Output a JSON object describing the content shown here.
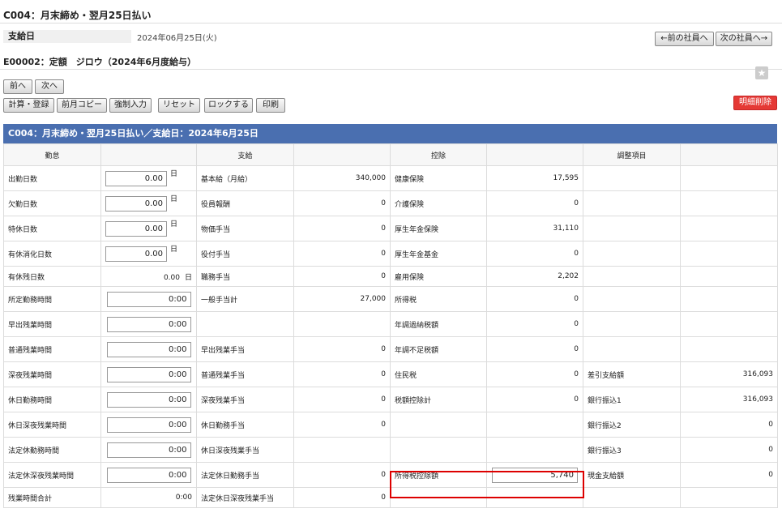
{
  "header": {
    "title": "C004：月末締め・翌月25日払い",
    "pay_label": "支給日",
    "pay_date": "2024年06月25日(火)",
    "prev_employee": "←前の社員へ",
    "next_employee": "次の社員へ→",
    "employee": "E00002：定額　ジロウ（2024年6月度給与）"
  },
  "toolbar": {
    "prev": "前へ",
    "next": "次へ",
    "calc": "計算・登録",
    "copy": "前月コピー",
    "force": "強制入力",
    "reset": "リセット",
    "lock": "ロックする",
    "print": "印刷",
    "delete": "明細削除"
  },
  "banner": "C004：月末締め・翌月25日払い／支給日：2024年6月25日",
  "columns": {
    "attendance": "勤怠",
    "payment": "支給",
    "deduction": "控除",
    "adjust": "調整項目"
  },
  "rows": [
    {
      "a": "出勤日数",
      "av": "0.00",
      "au": "日",
      "p": "基本給（月給）",
      "pv": "340,000",
      "d": "健康保険",
      "dv": "17,595",
      "j": "",
      "jv": ""
    },
    {
      "a": "欠勤日数",
      "av": "0.00",
      "au": "日",
      "p": "役員報酬",
      "pv": "0",
      "d": "介護保険",
      "dv": "0",
      "j": "",
      "jv": ""
    },
    {
      "a": "特休日数",
      "av": "0.00",
      "au": "日",
      "p": "物価手当",
      "pv": "0",
      "d": "厚生年金保険",
      "dv": "31,110",
      "j": "",
      "jv": ""
    },
    {
      "a": "有休消化日数",
      "av": "0.00",
      "au": "日",
      "p": "役付手当",
      "pv": "0",
      "d": "厚生年金基金",
      "dv": "0",
      "j": "",
      "jv": ""
    },
    {
      "a": "有休残日数",
      "av": "0.00",
      "au": "日",
      "p": "職務手当",
      "pv": "0",
      "d": "雇用保険",
      "dv": "2,202",
      "j": "",
      "jv": ""
    },
    {
      "a": "所定勤務時間",
      "av": "0:00",
      "au": "",
      "p": "一般手当計",
      "pv": "27,000",
      "d": "所得税",
      "dv": "0",
      "j": "",
      "jv": ""
    },
    {
      "a": "早出残業時間",
      "av": "0:00",
      "au": "",
      "p": "",
      "pv": "",
      "d": "年調過納税額",
      "dv": "0",
      "j": "",
      "jv": ""
    },
    {
      "a": "普通残業時間",
      "av": "0:00",
      "au": "",
      "p": "早出残業手当",
      "pv": "0",
      "d": "年調不足税額",
      "dv": "0",
      "j": "",
      "jv": ""
    },
    {
      "a": "深夜残業時間",
      "av": "0:00",
      "au": "",
      "p": "普通残業手当",
      "pv": "0",
      "d": "住民税",
      "dv": "0",
      "j": "差引支給額",
      "jv": "316,093"
    },
    {
      "a": "休日勤務時間",
      "av": "0:00",
      "au": "",
      "p": "深夜残業手当",
      "pv": "0",
      "d": "税額控除計",
      "dv": "0",
      "j": "銀行振込1",
      "jv": "316,093"
    },
    {
      "a": "休日深夜残業時間",
      "av": "0:00",
      "au": "",
      "p": "休日勤務手当",
      "pv": "0",
      "d": "",
      "dv": "",
      "j": "銀行振込2",
      "jv": "0"
    },
    {
      "a": "法定休勤務時間",
      "av": "0:00",
      "au": "",
      "p": "休日深夜残業手当",
      "pv": "",
      "d": "",
      "dv": "",
      "j": "銀行振込3",
      "jv": "0"
    },
    {
      "a": "法定休深夜残業時間",
      "av": "0:00",
      "au": "",
      "p": "法定休日勤務手当",
      "pv": "0",
      "d": "所得税控除額",
      "dv": "5,740",
      "j": "現金支給額",
      "jv": "0"
    },
    {
      "a": "残業時間合計",
      "av": "0:00",
      "au": "",
      "p": "法定休日深夜残業手当",
      "pv": "0",
      "d": "",
      "dv": "",
      "j": "",
      "jv": ""
    }
  ]
}
